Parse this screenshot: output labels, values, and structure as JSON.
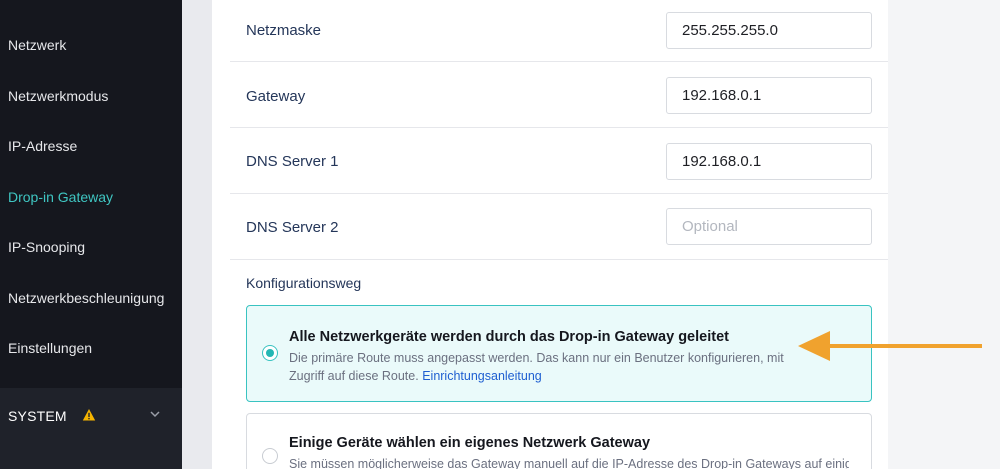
{
  "sidebar": {
    "items": [
      {
        "label": "Netzwerk",
        "active": false
      },
      {
        "label": "Netzwerkmodus",
        "active": false
      },
      {
        "label": "IP-Adresse",
        "active": false
      },
      {
        "label": "Drop-in Gateway",
        "active": true
      },
      {
        "label": "IP-Snooping",
        "active": false
      },
      {
        "label": "Netzwerkbeschleunigung",
        "active": false
      },
      {
        "label": "Einstellungen",
        "active": false
      }
    ],
    "system": {
      "label": "SYSTEM",
      "warning_icon": "warning-icon",
      "chevron_icon": "chevron-down-icon"
    }
  },
  "form": {
    "rows": [
      {
        "label": "Netzmaske",
        "value": "255.255.255.0",
        "placeholder": ""
      },
      {
        "label": "Gateway",
        "value": "192.168.0.1",
        "placeholder": ""
      },
      {
        "label": "DNS Server 1",
        "value": "192.168.0.1",
        "placeholder": ""
      },
      {
        "label": "DNS Server 2",
        "value": "",
        "placeholder": "Optional"
      }
    ],
    "config_label": "Konfigurationsweg",
    "options": [
      {
        "title": "Alle Netzwerkgeräte werden durch das Drop-in Gateway geleitet",
        "description": "Die primäre Route muss angepasst werden. Das kann nur ein Benutzer konfigurieren, mit Zugriff auf diese Route.",
        "link": "Einrichtungsanleitung",
        "selected": true
      },
      {
        "title": "Einige Geräte wählen ein eigenes Netzwerk Gateway",
        "description": "Sie müssen möglicherweise das Gateway manuell auf die IP-Adresse des Drop-in Gateways auf einigen",
        "selected": false
      }
    ]
  },
  "colors": {
    "accent": "#3fc6c2",
    "sidebar_bg": "#15171e",
    "arrow": "#f0a22e",
    "warning": "#f5b400",
    "link": "#1f5fd1"
  }
}
